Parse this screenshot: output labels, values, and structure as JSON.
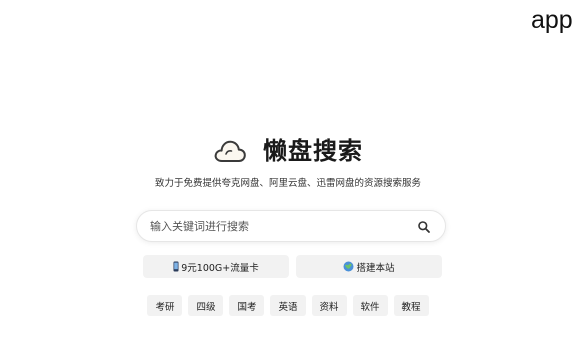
{
  "corner": {
    "text": "app"
  },
  "brand": {
    "icon": "cloud-icon",
    "title": "懒盘搜索"
  },
  "tagline": "致力于免费提供夸克网盘、阿里云盘、迅雷网盘的资源搜索服务",
  "search": {
    "placeholder": "输入关键词进行搜索",
    "value": "",
    "icon": "search-icon"
  },
  "quick_links": [
    {
      "icon": "phone-icon",
      "label": "9元100G+流量卡"
    },
    {
      "icon": "globe-icon",
      "label": "搭建本站"
    }
  ],
  "tags": [
    "考研",
    "四级",
    "国考",
    "英语",
    "资料",
    "软件",
    "教程"
  ]
}
